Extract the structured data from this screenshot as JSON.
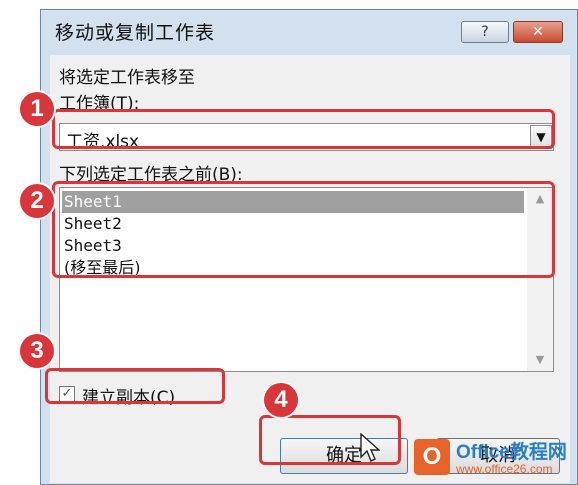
{
  "dialog": {
    "title": "移动或复制工作表",
    "help_label": "?",
    "close_label": "✕"
  },
  "move_label": "将选定工作表移至",
  "workbook_label": "工作簿(T):",
  "workbook_value": "工资.xlsx",
  "before_label": "下列选定工作表之前(B):",
  "sheets": [
    {
      "label": "Sheet1",
      "selected": true
    },
    {
      "label": "Sheet2",
      "selected": false
    },
    {
      "label": "Sheet3",
      "selected": false
    },
    {
      "label": "(移至最后)",
      "selected": false
    }
  ],
  "copy_checkbox": {
    "label": "建立副本(C)",
    "checked": true
  },
  "buttons": {
    "ok": "确定",
    "cancel": "取消"
  },
  "callouts": [
    "1",
    "2",
    "3",
    "4"
  ],
  "watermark": {
    "line1": "Office教程网",
    "line2": "www.office26.com",
    "mark": "O"
  },
  "colors": {
    "highlight": "#d8363a",
    "selection": "#a0a0a0"
  }
}
